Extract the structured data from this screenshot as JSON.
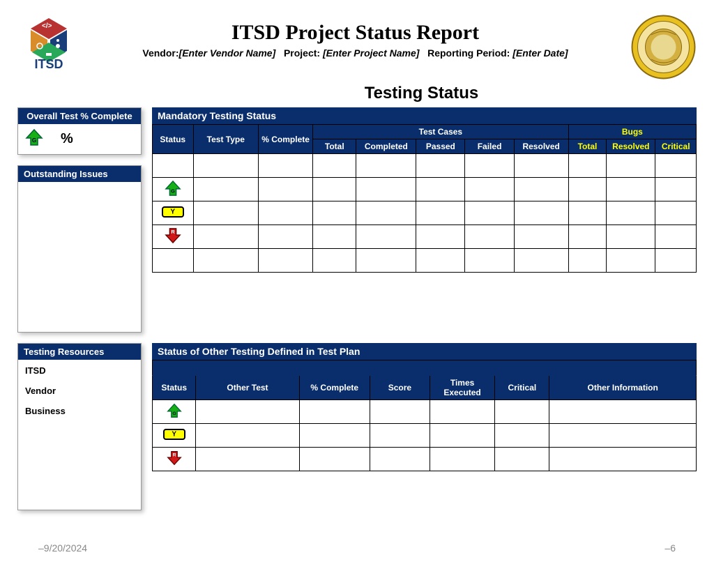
{
  "header": {
    "title": "ITSD Project Status Report",
    "vendor_label": "Vendor:",
    "vendor_placeholder": "[Enter Vendor Name]",
    "project_label": "Project:",
    "project_placeholder": "[Enter Project Name]",
    "period_label": "Reporting Period:",
    "period_placeholder": "[Enter Date]"
  },
  "section_title": "Testing Status",
  "left": {
    "overall_header": "Overall  Test % Complete",
    "overall_value": "%",
    "issues_header": "Outstanding Issues",
    "resources_header": "Testing Resources",
    "resources": {
      "r1": "ITSD",
      "r2": "Vendor",
      "r3": "Business"
    }
  },
  "table1": {
    "title": "Mandatory Testing Status",
    "group_testcases": "Test Cases",
    "group_bugs": "Bugs",
    "cols": {
      "status": "Status",
      "testtype": "Test Type",
      "pctcomplete": "% Complete",
      "total": "Total",
      "completed": "Completed",
      "passed": "Passed",
      "failed": "Failed",
      "resolved": "Resolved",
      "btotal": "Total",
      "bresolved": "Resolved",
      "bcritical": "Critical"
    }
  },
  "table2": {
    "title": "Status of Other Testing Defined in Test Plan",
    "cols": {
      "status": "Status",
      "othertest": "Other Test",
      "pctcomplete": "% Complete",
      "score": "Score",
      "times": "Times Executed",
      "critical": "Critical",
      "otherinfo": "Other Information"
    }
  },
  "footer": {
    "date": "–9/20/2024",
    "page": "–6"
  }
}
